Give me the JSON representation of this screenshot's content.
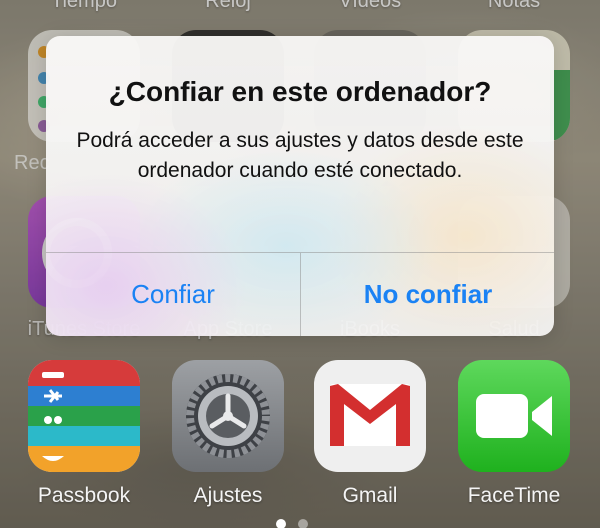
{
  "home_screen": {
    "top_row_labels": [
      "Tiempo",
      "Reloj",
      "Vídeos",
      "Notas"
    ],
    "second_row_partial_label": "Rec",
    "middle_row_labels": [
      "iTunes Store",
      "App Store",
      "iBooks",
      "Salud"
    ],
    "dock_row_labels": [
      "Passbook",
      "Ajustes",
      "Gmail",
      "FaceTime"
    ],
    "page_dots": 2
  },
  "alert": {
    "title": "¿Confiar en este ordenador?",
    "message": "Podrá acceder a sus ajustes y datos desde este ordenador cuando esté conectado.",
    "buttons": {
      "trust": "Confiar",
      "dont_trust": "No confiar"
    }
  },
  "colors": {
    "accent": "#1a82f4",
    "facetime_green": "#2fbf2d",
    "gmail_red": "#d32f2f"
  }
}
